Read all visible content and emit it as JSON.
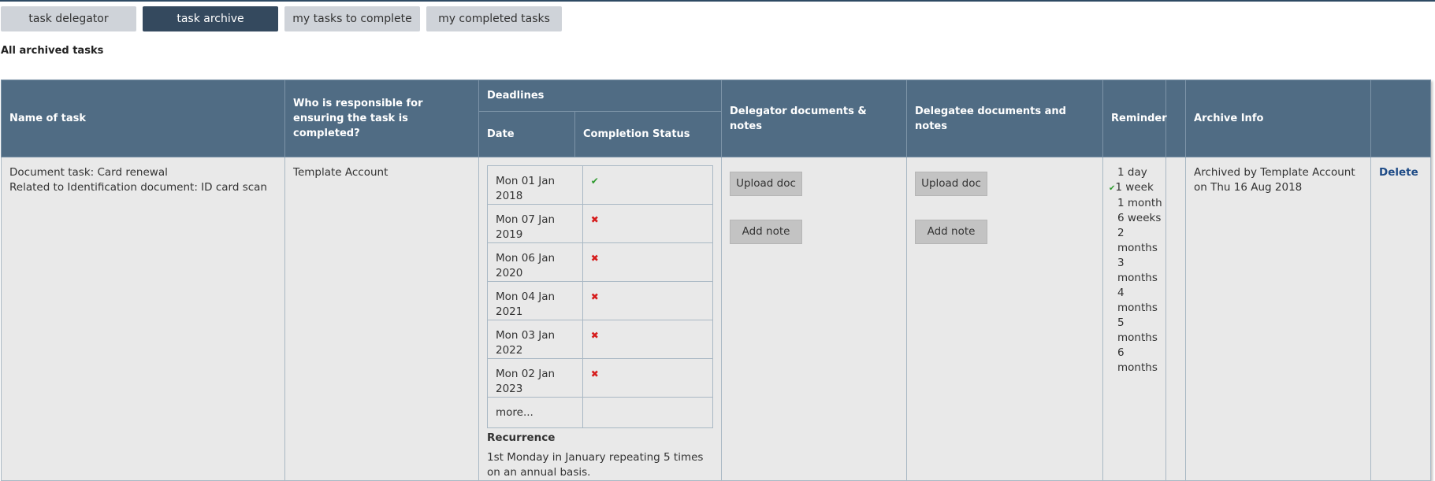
{
  "tabs": [
    {
      "label": "task delegator",
      "active": false
    },
    {
      "label": "task archive",
      "active": true
    },
    {
      "label": "my tasks to complete",
      "active": false
    },
    {
      "label": "my completed tasks",
      "active": false
    }
  ],
  "heading": "All archived tasks",
  "columns": {
    "name": "Name of task",
    "responsible": "Who is responsible for ensuring the task is completed?",
    "deadlines": "Deadlines",
    "date": "Date",
    "status": "Completion Status",
    "delegator": "Delegator documents & notes",
    "delegatee": "Delegatee documents and notes",
    "reminder": "Reminder",
    "archive": "Archive Info"
  },
  "row": {
    "task_line1": "Document task: Card renewal",
    "task_line2": "Related to Identification document: ID card scan",
    "responsible": "Template Account",
    "deadlines": [
      {
        "date": "Mon 01 Jan 2018",
        "status": "done"
      },
      {
        "date": "Mon 07 Jan 2019",
        "status": "missed"
      },
      {
        "date": "Mon 06 Jan 2020",
        "status": "missed"
      },
      {
        "date": "Mon 04 Jan 2021",
        "status": "missed"
      },
      {
        "date": "Mon 03 Jan 2022",
        "status": "missed"
      },
      {
        "date": "Mon 02 Jan 2023",
        "status": "missed"
      }
    ],
    "more_label": "more...",
    "recurrence_label": "Recurrence",
    "recurrence_text": "1st Monday in January repeating 5 times on an annual basis.",
    "upload_label": "Upload doc",
    "note_label": "Add note",
    "reminders": [
      {
        "label": "1 day",
        "selected": false
      },
      {
        "label": "1 week",
        "selected": true
      },
      {
        "label": "1 month",
        "selected": false
      },
      {
        "label": "6 weeks",
        "selected": false
      },
      {
        "label": "2 months",
        "selected": false
      },
      {
        "label": "3 months",
        "selected": false
      },
      {
        "label": "4 months",
        "selected": false
      },
      {
        "label": "5 months",
        "selected": false
      },
      {
        "label": "6 months",
        "selected": false
      }
    ],
    "archive_line1": "Archived by Template Account",
    "archive_line2": "on Thu 16 Aug 2018",
    "delete_label": "Delete"
  },
  "icons": {
    "done": "check-icon",
    "missed": "cross-icon"
  },
  "colors": {
    "header_bg": "#506c84",
    "active_tab": "#34495e",
    "check": "#2e9a2e",
    "cross": "#d61c1c",
    "link": "#1e4b86"
  }
}
